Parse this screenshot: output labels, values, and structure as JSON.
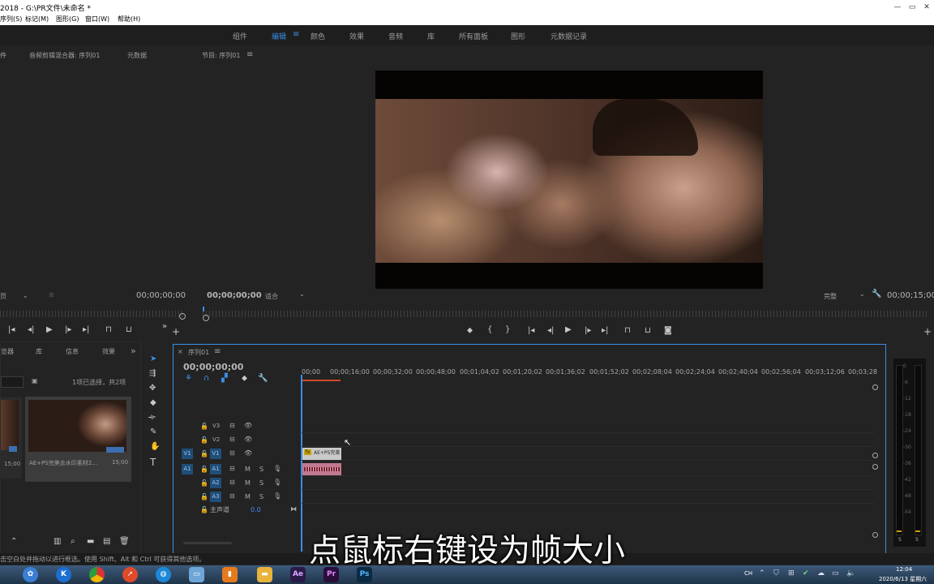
{
  "window": {
    "title": "2018 - G:\\PR文件\\未命名 *",
    "minimize": "—",
    "restore": "▭",
    "close": "✕"
  },
  "menu": [
    "序列(S)",
    "标记(M)",
    "图形(G)",
    "窗口(W)",
    "帮助(H)"
  ],
  "workspaces": [
    {
      "label": "组件",
      "active": false
    },
    {
      "label": "编辑",
      "active": true
    },
    {
      "label": "颜色",
      "active": false
    },
    {
      "label": "效果",
      "active": false
    },
    {
      "label": "音频",
      "active": false
    },
    {
      "label": "库",
      "active": false
    },
    {
      "label": "所有面板",
      "active": false
    },
    {
      "label": "图形",
      "active": false
    },
    {
      "label": "元数据记录",
      "active": false
    }
  ],
  "source_panel": {
    "tab_partial": "件",
    "tab_audio_mixer": "音频剪辑混合器: 序列01",
    "tab_metadata": "元数据",
    "page_dropdown": "页",
    "timecode": "00;00;00;00"
  },
  "program_panel": {
    "title": "节目: 序列01",
    "timecode": "00;00;00;00",
    "fit": "适合",
    "quality": "完整",
    "duration": "00;00;15;00"
  },
  "project_panel": {
    "tabs": [
      "览器",
      "库",
      "信息",
      "效果"
    ],
    "more": "»",
    "selection_info": "1项已选择，共2项",
    "items": [
      {
        "name": "",
        "duration": "15;00"
      },
      {
        "name": "AE+PS完美去水印素材2...",
        "duration": "15;00"
      }
    ]
  },
  "timeline": {
    "tab": "序列01",
    "timecode": "00;00;00;00",
    "ruler": [
      "00;00",
      "00;00;16;00",
      "00;00;32;00",
      "00;00;48;00",
      "00;01;04;02",
      "00;01;20;02",
      "00;01;36;02",
      "00;01;52;02",
      "00;02;08;04",
      "00;02;24;04",
      "00;02;40;04",
      "00;02;56;04",
      "00;03;12;06",
      "00;03;28"
    ],
    "video_tracks": [
      {
        "label": "V3"
      },
      {
        "label": "V2"
      },
      {
        "label": "V1",
        "source": "V1"
      }
    ],
    "audio_tracks": [
      {
        "label": "A1",
        "source": "A1"
      },
      {
        "label": "A2"
      },
      {
        "label": "A3"
      }
    ],
    "master": {
      "label": "主声道",
      "value": "0.0"
    },
    "mute": "M",
    "solo": "S",
    "video_clip_label": "AE+PS完美",
    "fx_badge": "fx"
  },
  "vu_meter": {
    "scale": [
      "0",
      "-6",
      "-12",
      "-18",
      "-24",
      "-30",
      "-36",
      "-42",
      "-48",
      "-54"
    ],
    "solo_left": "S",
    "solo_right": "S"
  },
  "tool_text": "T",
  "status_bar": "击空白处并拖动以进行框选。使用 Shift、Alt 和 Ctrl 可获得其他选项。",
  "subtitle": "点鼠标右键设为帧大小",
  "taskbar": {
    "apps": [
      {
        "name": "k-icon",
        "label": "K",
        "color": "#1b6fd0"
      },
      {
        "name": "chrome-icon",
        "label": "",
        "color": "#d33"
      },
      {
        "name": "compass-icon",
        "label": "",
        "color": "#e04a2a"
      },
      {
        "name": "globe-icon",
        "label": "",
        "color": "#1c88d8"
      },
      {
        "name": "folder-icon",
        "label": "",
        "color": "#e8b43c"
      },
      {
        "name": "ae-icon",
        "label": "Ae",
        "color": "#2a1a4a"
      },
      {
        "name": "pr-icon",
        "label": "Pr",
        "color": "#2a0f3d"
      },
      {
        "name": "ps-icon",
        "label": "Ps",
        "color": "#0b2a44"
      }
    ],
    "lang": "CH",
    "time": "12:04",
    "date": "2020/6/13 星期六"
  }
}
